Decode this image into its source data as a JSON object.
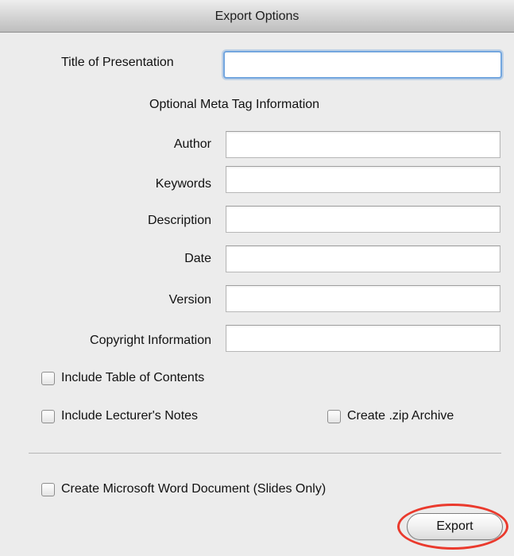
{
  "window": {
    "title": "Export Options"
  },
  "form": {
    "title_label": "Title of Presentation",
    "title_value": "",
    "meta_heading": "Optional Meta Tag Information",
    "author_label": "Author",
    "author_value": "",
    "keywords_label": "Keywords",
    "keywords_value": "",
    "description_label": "Description",
    "description_value": "",
    "date_label": "Date",
    "date_value": "",
    "version_label": "Version",
    "version_value": "",
    "copyright_label": "Copyright Information",
    "copyright_value": ""
  },
  "options": {
    "include_toc_label": "Include Table of Contents",
    "include_toc_checked": false,
    "include_notes_label": "Include Lecturer's Notes",
    "include_notes_checked": false,
    "create_zip_label": "Create .zip Archive",
    "create_zip_checked": false,
    "word_doc_label": "Create Microsoft Word Document (Slides Only)",
    "word_doc_checked": false
  },
  "actions": {
    "export_label": "Export"
  },
  "colors": {
    "focus_ring": "#73a6df",
    "annotation_ring": "#ea3a2d"
  }
}
